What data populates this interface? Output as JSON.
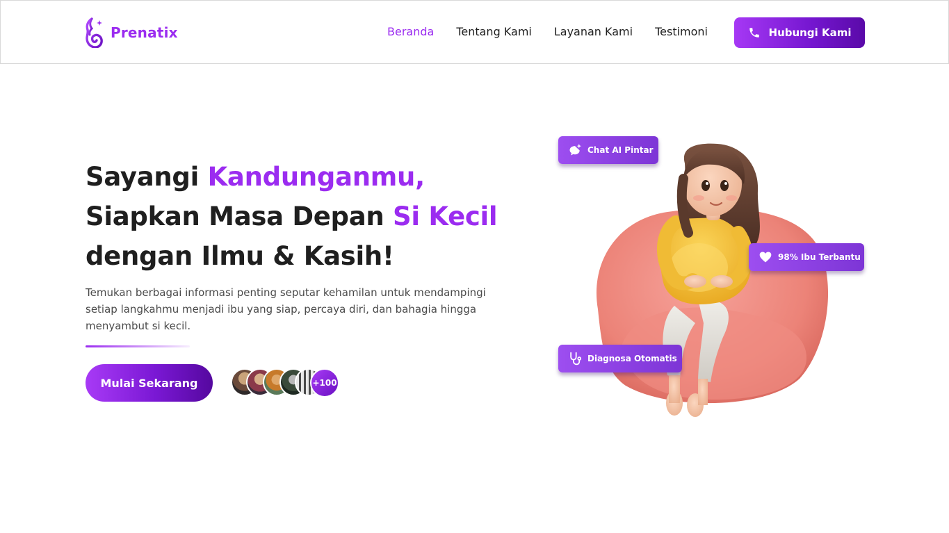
{
  "brand": {
    "name": "Prenatix",
    "color": "#9b2cf0",
    "logo_icon": "pregnant-mother-icon"
  },
  "nav": {
    "links": [
      {
        "label": "Beranda",
        "active": true
      },
      {
        "label": "Tentang Kami",
        "active": false
      },
      {
        "label": "Layanan Kami",
        "active": false
      },
      {
        "label": "Testimoni",
        "active": false
      }
    ],
    "cta": {
      "label": "Hubungi Kami",
      "icon": "phone-icon"
    }
  },
  "hero": {
    "title": {
      "line1_plain": "Sayangi ",
      "line1_accent": "Kandunganmu,",
      "line2_plain": "Siapkan Masa Depan ",
      "line2_accent": "Si Kecil",
      "line3_plain": "dengan Ilmu & Kasih!"
    },
    "description": "Temukan berbagai informasi penting seputar kehamilan untuk mendampingi setiap langkahmu menjadi ibu yang siap, percaya diri, dan bahagia hingga menyambut si kecil.",
    "cta_label": "Mulai Sekarang",
    "avatars_count_label": "+100"
  },
  "badges": {
    "chat": {
      "label": "Chat AI Pintar",
      "icon": "chat-sparkle-icon"
    },
    "trust": {
      "label": "98% Ibu Terbantu",
      "icon": "heart-icon"
    },
    "diagnosis": {
      "label": "Diagnosa Otomatis",
      "icon": "stethoscope-icon"
    }
  },
  "colors": {
    "accent": "#9b2cf0",
    "accent_dark": "#5a0aa8",
    "text": "#1f1f1f",
    "muted": "#4a4a4a"
  }
}
